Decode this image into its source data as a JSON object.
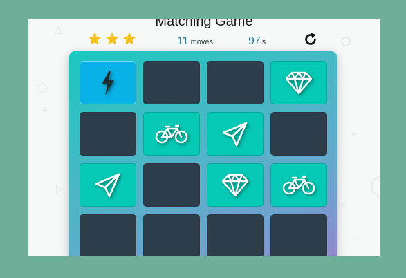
{
  "game": {
    "title": "Matching Game",
    "stars": 3,
    "moves_count": "11",
    "moves_unit": "moves",
    "timer_value": "97",
    "timer_unit": "s"
  },
  "colors": {
    "background": "#6fae98",
    "star": "#f6c11c",
    "card_closed": "#2e3d4a",
    "card_matched": "#05c9b4",
    "card_open": "#08b1e6"
  },
  "cards": [
    {
      "state": "open",
      "icon": "bolt-icon"
    },
    {
      "state": "closed",
      "icon": ""
    },
    {
      "state": "closed",
      "icon": ""
    },
    {
      "state": "matched",
      "icon": "diamond-icon"
    },
    {
      "state": "closed",
      "icon": ""
    },
    {
      "state": "matched",
      "icon": "bicycle-icon"
    },
    {
      "state": "matched",
      "icon": "paper-plane-icon"
    },
    {
      "state": "closed",
      "icon": ""
    },
    {
      "state": "matched",
      "icon": "paper-plane-icon"
    },
    {
      "state": "closed",
      "icon": ""
    },
    {
      "state": "matched",
      "icon": "diamond-icon"
    },
    {
      "state": "matched",
      "icon": "bicycle-icon"
    },
    {
      "state": "closed",
      "icon": ""
    },
    {
      "state": "closed",
      "icon": ""
    },
    {
      "state": "closed",
      "icon": ""
    },
    {
      "state": "closed",
      "icon": ""
    }
  ]
}
